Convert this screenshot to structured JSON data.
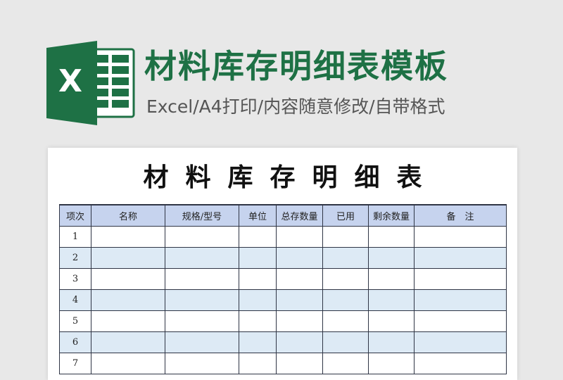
{
  "header": {
    "title": "材料库存明细表模板",
    "subtitle": "Excel/A4打印/内容随意修改/自带格式",
    "logo_letter": "X"
  },
  "colors": {
    "excel_green": "#1e7145",
    "header_fill": "#c6d3ee",
    "row_alt": "#ddeaf5"
  },
  "sheet": {
    "title": "材料库存明细表",
    "columns": [
      "项次",
      "名称",
      "规格/型号",
      "单位",
      "总存数量",
      "已用",
      "剩余数量",
      "备　注"
    ],
    "rows": [
      "1",
      "2",
      "3",
      "4",
      "5",
      "6",
      "7"
    ]
  }
}
